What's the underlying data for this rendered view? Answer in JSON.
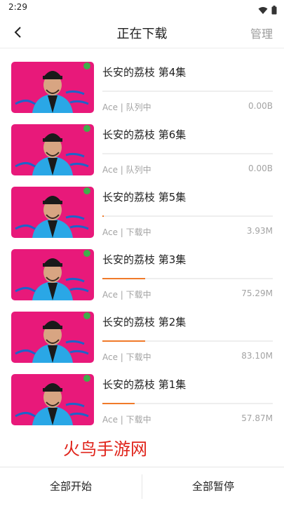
{
  "status_bar": {
    "time": "2:29",
    "icons": [
      "wifi-icon",
      "battery-icon"
    ]
  },
  "nav": {
    "title": "正在下载",
    "manage_label": "管理",
    "back_icon": "chevron-left-icon"
  },
  "colors": {
    "accent": "#f07a2a",
    "thumb_bg": "#e8197a",
    "robe": "#2aa7e6",
    "watermark": "#e0241b"
  },
  "items": [
    {
      "title": "长安的荔枝 第4集",
      "meta": "Ace | 队列中",
      "size": "0.00B",
      "progress": 0.0
    },
    {
      "title": "长安的荔枝 第6集",
      "meta": "Ace | 队列中",
      "size": "0.00B",
      "progress": 0.0
    },
    {
      "title": "长安的荔枝 第5集",
      "meta": "Ace | 下载中",
      "size": "3.93M",
      "progress": 0.01
    },
    {
      "title": "长安的荔枝 第3集",
      "meta": "Ace | 下载中",
      "size": "75.29M",
      "progress": 0.25
    },
    {
      "title": "长安的荔枝 第2集",
      "meta": "Ace | 下载中",
      "size": "83.10M",
      "progress": 0.25
    },
    {
      "title": "长安的荔枝 第1集",
      "meta": "Ace | 下载中",
      "size": "57.87M",
      "progress": 0.19
    }
  ],
  "watermark": "火鸟手游网",
  "bottom": {
    "start_all": "全部开始",
    "pause_all": "全部暂停"
  }
}
